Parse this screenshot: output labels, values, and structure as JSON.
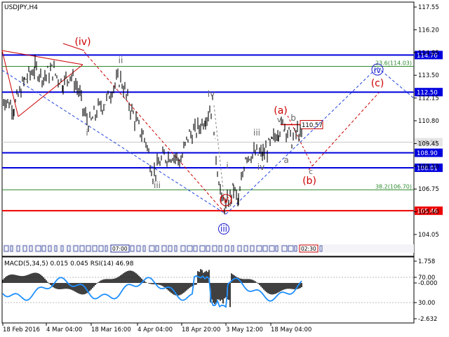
{
  "window": {
    "title": "USDJPY,H4",
    "indicator_title": "MACD(5,34,5) 0.015 0.045 RSI(14) 46.98"
  },
  "colors": {
    "level_blue": "#0000dd",
    "level_red": "#ee0000",
    "fib_green": "#2e8b2e",
    "wave_red": "#cc0000",
    "wave_gray": "#666666",
    "wave_blue": "#1a1acc",
    "price": "#000000",
    "rsi": "#1e8fff",
    "macd": "#000000"
  },
  "chart_data": {
    "type": "line",
    "price_axis": {
      "ticks": [
        "117.55",
        "116.20",
        "114.85",
        "113.50",
        "112.15",
        "110.80",
        "109.45",
        "108.10",
        "106.75",
        "105.40",
        "104.05"
      ],
      "ylim": [
        103.3,
        118.1
      ]
    },
    "time_axis": {
      "labels": [
        "18 Feb 2016",
        "4 Mar 04:00",
        "18 Mar 16:00",
        "4 Apr 04:00",
        "18 Apr 20:00",
        "3 May 12:00",
        "18 May 04:00"
      ]
    },
    "levels": [
      {
        "label": "114.70",
        "value": 114.7,
        "kind": "blue"
      },
      {
        "label": "112.50",
        "value": 112.5,
        "kind": "blue"
      },
      {
        "label": "108.90",
        "value": 108.9,
        "kind": "blue"
      },
      {
        "label": "108.01",
        "value": 108.01,
        "kind": "blue"
      },
      {
        "label": "105.46",
        "value": 105.46,
        "kind": "red"
      }
    ],
    "current_price": {
      "label": "109.53",
      "value": 109.53
    },
    "marker_price": {
      "label": "110.57",
      "value": 110.57
    },
    "fib_levels": [
      {
        "label": "23.6(114.03)",
        "value": 114.03
      },
      {
        "label": "38.2(106.70)",
        "value": 106.7
      }
    ],
    "wave_labels": [
      {
        "text": "(iv)",
        "color": "wave_red"
      },
      {
        "text": "ii",
        "color": "wave_gray"
      },
      {
        "text": "i",
        "color": "wave_gray"
      },
      {
        "text": "iii",
        "color": "wave_gray"
      },
      {
        "text": "iv",
        "color": "wave_gray"
      },
      {
        "text": "(v)",
        "color": "wave_red"
      },
      {
        "text": "iii",
        "color": "wave_blue"
      },
      {
        "text": "i",
        "color": "wave_gray"
      },
      {
        "text": "ii",
        "color": "wave_gray"
      },
      {
        "text": "iii",
        "color": "wave_gray"
      },
      {
        "text": "iv",
        "color": "wave_gray"
      },
      {
        "text": "(a)",
        "color": "wave_red"
      },
      {
        "text": "v",
        "color": "wave_gray"
      },
      {
        "text": "b",
        "color": "wave_gray"
      },
      {
        "text": "a",
        "color": "wave_gray"
      },
      {
        "text": "c",
        "color": "wave_gray"
      },
      {
        "text": "(b)",
        "color": "wave_red"
      },
      {
        "text": "(c)",
        "color": "wave_red"
      },
      {
        "text": "iv",
        "color": "wave_blue"
      }
    ],
    "indicator_axis": {
      "ticks": [
        "1.758",
        "70.00",
        "-0.000",
        "30.00",
        "-2.632"
      ]
    },
    "session_labels": [
      "07:00",
      "02:30"
    ]
  }
}
